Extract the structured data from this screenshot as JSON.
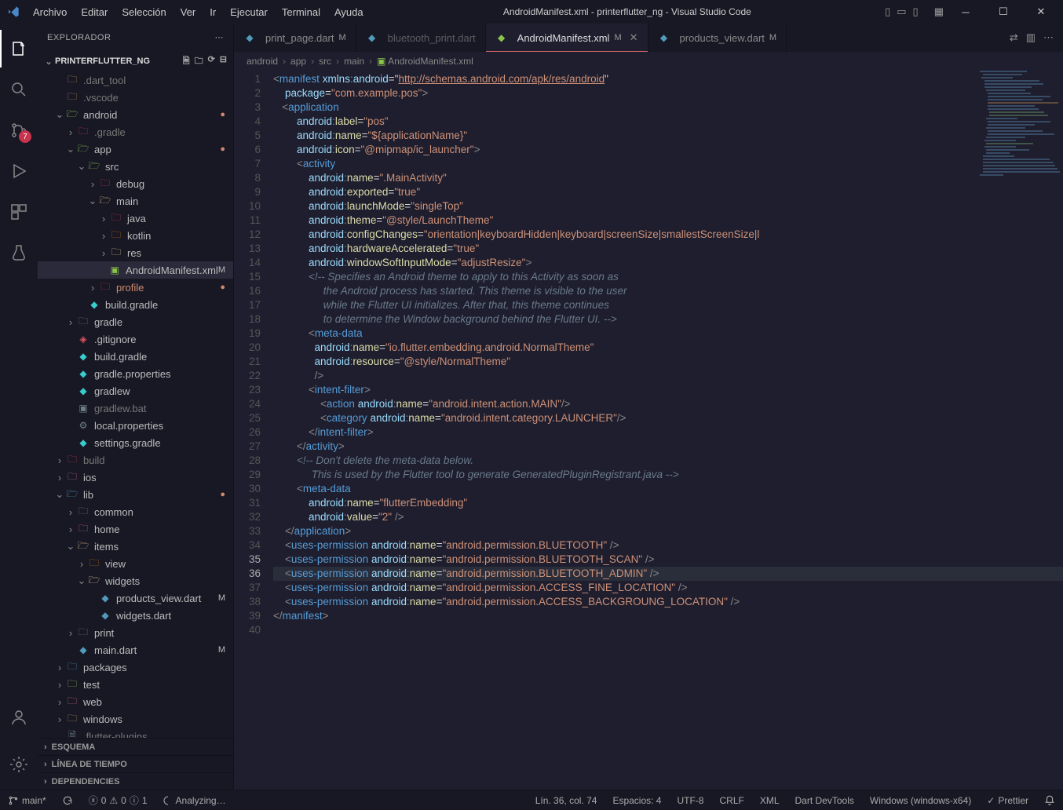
{
  "window": {
    "title": "AndroidManifest.xml - printerflutter_ng - Visual Studio Code"
  },
  "menu": {
    "file": "Archivo",
    "edit": "Editar",
    "selection": "Selección",
    "view": "Ver",
    "go": "Ir",
    "run": "Ejecutar",
    "terminal": "Terminal",
    "help": "Ayuda"
  },
  "activity": {
    "badge_scm": "7"
  },
  "sidebar": {
    "title": "EXPLORADOR",
    "project": "PRINTERFLUTTER_NG",
    "tree": [
      {
        "indent": 1,
        "chev": "",
        "icon": "folder",
        "label": ".dart_tool",
        "dim": true
      },
      {
        "indent": 1,
        "chev": "",
        "icon": "folder",
        "label": ".vscode",
        "dim": true
      },
      {
        "indent": 1,
        "chev": "v",
        "icon": "folder-open-green",
        "label": "android",
        "mod": "dot"
      },
      {
        "indent": 2,
        "chev": ">",
        "icon": "folder-red",
        "label": ".gradle",
        "dim": true
      },
      {
        "indent": 2,
        "chev": "v",
        "icon": "folder-open-green",
        "label": "app",
        "mod": "dot"
      },
      {
        "indent": 3,
        "chev": "v",
        "icon": "folder-open-green",
        "label": "src"
      },
      {
        "indent": 4,
        "chev": ">",
        "icon": "folder-red",
        "label": "debug"
      },
      {
        "indent": 4,
        "chev": "v",
        "icon": "folder-open",
        "label": "main"
      },
      {
        "indent": 5,
        "chev": ">",
        "icon": "folder-red",
        "label": "java"
      },
      {
        "indent": 5,
        "chev": ">",
        "icon": "folder-orange",
        "label": "kotlin"
      },
      {
        "indent": 5,
        "chev": ">",
        "icon": "folder-yellow",
        "label": "res"
      },
      {
        "indent": 5,
        "chev": "",
        "icon": "android",
        "label": "AndroidManifest.xml",
        "mod": "M",
        "selected": true
      },
      {
        "indent": 4,
        "chev": ">",
        "icon": "folder-red",
        "label": "profile",
        "mod": "dot",
        "color": "#d08a6e"
      },
      {
        "indent": 3,
        "chev": "",
        "icon": "gradle",
        "label": "build.gradle"
      },
      {
        "indent": 2,
        "chev": ">",
        "icon": "folder-grey",
        "label": "gradle"
      },
      {
        "indent": 2,
        "chev": "",
        "icon": "git",
        "label": ".gitignore"
      },
      {
        "indent": 2,
        "chev": "",
        "icon": "gradle",
        "label": "build.gradle"
      },
      {
        "indent": 2,
        "chev": "",
        "icon": "gradle",
        "label": "gradle.properties"
      },
      {
        "indent": 2,
        "chev": "",
        "icon": "gradle",
        "label": "gradlew"
      },
      {
        "indent": 2,
        "chev": "",
        "icon": "bat",
        "label": "gradlew.bat",
        "dim": true
      },
      {
        "indent": 2,
        "chev": "",
        "icon": "settings",
        "label": "local.properties"
      },
      {
        "indent": 2,
        "chev": "",
        "icon": "gradle",
        "label": "settings.gradle"
      },
      {
        "indent": 1,
        "chev": ">",
        "icon": "folder-red",
        "label": "build",
        "dim": true
      },
      {
        "indent": 1,
        "chev": ">",
        "icon": "folder-pink",
        "label": "ios"
      },
      {
        "indent": 1,
        "chev": "v",
        "icon": "folder-open-blue",
        "label": "lib",
        "mod": "dot"
      },
      {
        "indent": 2,
        "chev": ">",
        "icon": "folder-grey",
        "label": "common"
      },
      {
        "indent": 2,
        "chev": ">",
        "icon": "folder-pink",
        "label": "home"
      },
      {
        "indent": 2,
        "chev": "v",
        "icon": "folder-open",
        "label": "items"
      },
      {
        "indent": 3,
        "chev": ">",
        "icon": "folder-orange",
        "label": "view"
      },
      {
        "indent": 3,
        "chev": "v",
        "icon": "folder-open-yellow",
        "label": "widgets"
      },
      {
        "indent": 4,
        "chev": "",
        "icon": "dart",
        "label": "products_view.dart",
        "mod": "M"
      },
      {
        "indent": 4,
        "chev": "",
        "icon": "dart",
        "label": "widgets.dart"
      },
      {
        "indent": 2,
        "chev": ">",
        "icon": "folder-grey",
        "label": "print"
      },
      {
        "indent": 2,
        "chev": "",
        "icon": "dart",
        "label": "main.dart",
        "mod": "M"
      },
      {
        "indent": 1,
        "chev": ">",
        "icon": "folder-blue",
        "label": "packages"
      },
      {
        "indent": 1,
        "chev": ">",
        "icon": "folder-green",
        "label": "test"
      },
      {
        "indent": 1,
        "chev": ">",
        "icon": "folder-pink",
        "label": "web"
      },
      {
        "indent": 1,
        "chev": ">",
        "icon": "folder",
        "label": "windows"
      },
      {
        "indent": 1,
        "chev": "",
        "icon": "file",
        "label": ".flutter-plugins",
        "dim": true
      }
    ],
    "panels": {
      "outline": "ESQUEMA",
      "timeline": "LÍNEA DE TIEMPO",
      "deps": "DEPENDENCIES"
    }
  },
  "tabs": [
    {
      "icon": "dart",
      "label": "print_page.dart",
      "mod": "M",
      "active": false,
      "color": "#519aba"
    },
    {
      "icon": "dart",
      "label": "bluetooth_print.dart",
      "mod": "",
      "active": false,
      "dim": true,
      "color": "#519aba"
    },
    {
      "icon": "android",
      "label": "AndroidManifest.xml",
      "mod": "M",
      "active": true,
      "close": true,
      "color": "#8bc34a"
    },
    {
      "icon": "dart",
      "label": "products_view.dart",
      "mod": "M",
      "active": false,
      "color": "#519aba"
    }
  ],
  "breadcrumb": [
    "android",
    "app",
    "src",
    "main",
    "AndroidManifest.xml"
  ],
  "code": {
    "cursor_line": 36,
    "lines": 40
  },
  "statusbar": {
    "branch": "main*",
    "sync": "",
    "errors": "0",
    "warnings": "0",
    "info": "1",
    "analyzing": "Analyzing…",
    "linecol": "Lín. 36, col. 74",
    "spaces": "Espacios: 4",
    "encoding": "UTF-8",
    "eol": "CRLF",
    "lang": "XML",
    "devtools": "Dart DevTools",
    "target": "Windows (windows-x64)",
    "prettier": "Prettier"
  },
  "chart_data": null
}
